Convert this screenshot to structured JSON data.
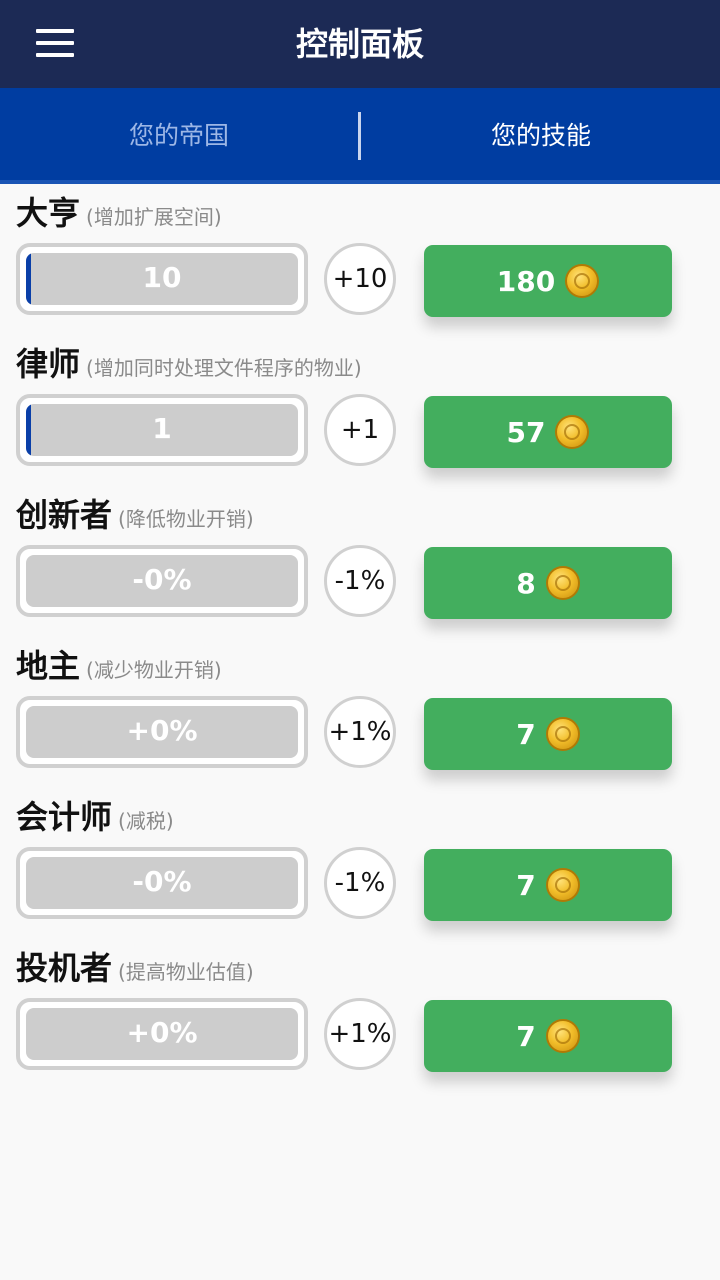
{
  "header": {
    "title": "控制面板"
  },
  "tabs": {
    "empire": "您的帝国",
    "skills": "您的技能"
  },
  "skills": [
    {
      "name": "大亨",
      "desc": "(增加扩展空间)",
      "bar_value": "10",
      "bar_fill_fraction": 0.02,
      "increment": "+10",
      "price": "180"
    },
    {
      "name": "律师",
      "desc": "(增加同时处理文件程序的物业)",
      "bar_value": "1",
      "bar_fill_fraction": 0.02,
      "increment": "+1",
      "price": "57"
    },
    {
      "name": "创新者",
      "desc": "(降低物业开销)",
      "bar_value": "-0%",
      "bar_fill_fraction": 0,
      "increment": "-1%",
      "price": "8"
    },
    {
      "name": "地主",
      "desc": "(减少物业开销)",
      "bar_value": "+0%",
      "bar_fill_fraction": 0,
      "increment": "+1%",
      "price": "7"
    },
    {
      "name": "会计师",
      "desc": "(减税)",
      "bar_value": "-0%",
      "bar_fill_fraction": 0,
      "increment": "-1%",
      "price": "7"
    },
    {
      "name": "投机者",
      "desc": "(提高物业估值)",
      "bar_value": "+0%",
      "bar_fill_fraction": 0,
      "increment": "+1%",
      "price": "7"
    }
  ],
  "icons": {
    "menu": "hamburger-menu-icon",
    "coin": "gold-coin-icon"
  },
  "colors": {
    "appbar": "#1c2a55",
    "tabbar": "#003da1",
    "buy_button": "#43ae5e",
    "bar_fill": "#0a3fa8"
  }
}
